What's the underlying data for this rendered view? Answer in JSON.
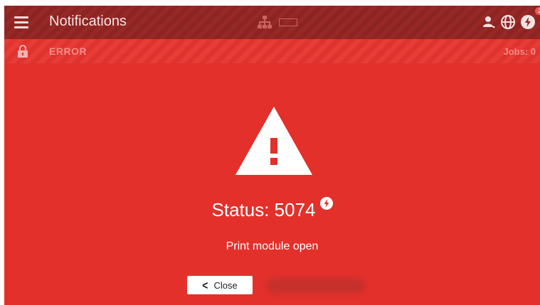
{
  "header": {
    "title": "Notifications",
    "menu_icon": "hamburger-menu-icon",
    "badge_count": "2",
    "icons": [
      "network-icon",
      "document-icon",
      "user-icon",
      "globe-icon",
      "power-icon"
    ]
  },
  "status_bar": {
    "state": "ERROR",
    "jobs": "Jobs: 0",
    "lock_icon": "lock-icon"
  },
  "alert": {
    "icon": "warning-triangle-icon",
    "status": "Status: 5074",
    "status_icon": "power-icon",
    "message": "Print module open"
  },
  "actions": {
    "close_label": "Close",
    "close_icon": "chevron-left-icon"
  },
  "colors": {
    "background": "#e3302b",
    "topbar": "#8c2422",
    "statusbar": "#e63d37",
    "muted_text": "#f18d88"
  }
}
